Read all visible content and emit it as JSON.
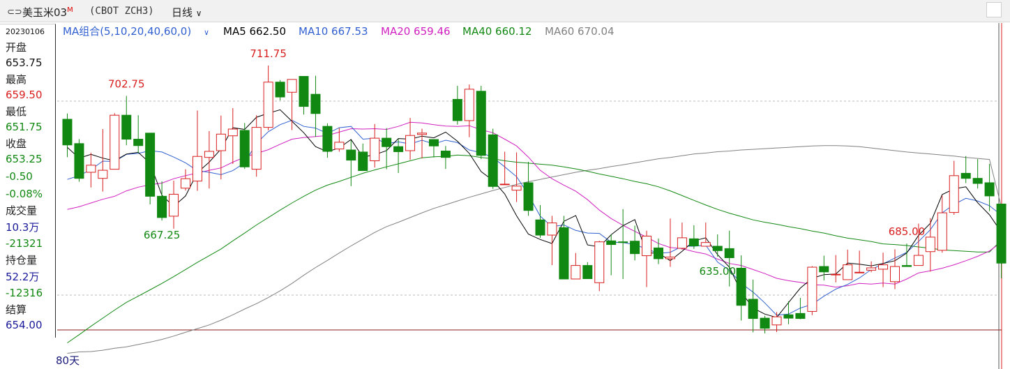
{
  "header": {
    "instrument_name": "美玉米03",
    "flag": "M",
    "code": "(CBOT ZCH3)",
    "period": "日线",
    "close_label": "□"
  },
  "info_panel": {
    "date": "20230106",
    "open_label": "开盘",
    "open_value": "653.75",
    "high_label": "最高",
    "high_value": "659.50",
    "low_label": "最低",
    "low_value": "651.75",
    "close_label": "收盘",
    "close_value": "653.25",
    "change_value": "-0.50",
    "change_pct": "-0.08%",
    "volume_label": "成交量",
    "volume_value": "10.3万",
    "volume_change": "-21321",
    "oi_label": "持仓量",
    "oi_value": "52.2万",
    "oi_change": "-12316",
    "settle_label": "结算",
    "settle_value": "654.00"
  },
  "legend": {
    "group_label": "MA组合(5,10,20,40,60,0)",
    "items": [
      {
        "text": "MA5 662.50",
        "color": "#000000"
      },
      {
        "text": "MA10 667.53",
        "color": "#3060d0"
      },
      {
        "text": "MA20 659.46",
        "color": "#d020c0"
      },
      {
        "text": "MA40 660.12",
        "color": "#118811"
      },
      {
        "text": "MA60 670.04",
        "color": "#808080"
      }
    ]
  },
  "bottom_label": "80天",
  "colors": {
    "up": "#d81e1e",
    "down": "#118811",
    "ma5": "#000000",
    "ma10": "#3060d0",
    "ma20": "#d020c0",
    "ma40": "#118811",
    "ma60": "#808080"
  },
  "chart_data": {
    "type": "candlestick",
    "ylim": [
      630,
      718
    ],
    "annotations": [
      {
        "text": "702.75",
        "kind": "high",
        "index": 5
      },
      {
        "text": "711.75",
        "kind": "high",
        "index": 17
      },
      {
        "text": "667.25",
        "kind": "low",
        "index": 8
      },
      {
        "text": "685.00",
        "kind": "high",
        "index": 71
      },
      {
        "text": "635.00",
        "kind": "low",
        "index": 55
      }
    ],
    "candles": [
      [
        695.9,
        688.3,
        697.6,
        684.7
      ],
      [
        688.7,
        678.4,
        690.0,
        677.4
      ],
      [
        680.2,
        682.3,
        686.0,
        675.7
      ],
      [
        678.4,
        680.8,
        693.0,
        674.5
      ],
      [
        681.1,
        697.1,
        697.7,
        681.1
      ],
      [
        697.1,
        690.0,
        702.8,
        688.2
      ],
      [
        690.0,
        688.1,
        697.1,
        685.9
      ],
      [
        691.8,
        673.1,
        691.8,
        670.7
      ],
      [
        673.1,
        666.8,
        677.5,
        665.9
      ],
      [
        667.2,
        673.7,
        677.7,
        663.5
      ],
      [
        675.5,
        678.3,
        681.1,
        674.8
      ],
      [
        677.6,
        684.9,
        698.5,
        674.7
      ],
      [
        684.6,
        686.4,
        692.4,
        675.4
      ],
      [
        686.6,
        691.5,
        697.0,
        678.1
      ],
      [
        691.0,
        693.0,
        699.2,
        682.7
      ],
      [
        692.6,
        681.8,
        694.8,
        681.2
      ],
      [
        681.1,
        693.5,
        697.1,
        678.9
      ],
      [
        693.5,
        706.9,
        711.8,
        692.6
      ],
      [
        706.9,
        702.5,
        707.5,
        701.5
      ],
      [
        703.9,
        707.7,
        707.2,
        692.7
      ],
      [
        708.6,
        699.7,
        707.0,
        697.3
      ],
      [
        703.3,
        697.6,
        708.8,
        690.7
      ],
      [
        693.8,
        686.4,
        694.7,
        684.5
      ],
      [
        687.1,
        689.1,
        693.3,
        686.3
      ],
      [
        686.8,
        683.8,
        689.7,
        676.1
      ],
      [
        686.2,
        680.7,
        688.7,
        680.7
      ],
      [
        683.6,
        690.3,
        694.5,
        681.6
      ],
      [
        690.3,
        687.8,
        693.3,
        681.1
      ],
      [
        687.8,
        686.3,
        690.1,
        680.0
      ],
      [
        686.6,
        691.1,
        696.3,
        683.9
      ],
      [
        691.4,
        691.8,
        693.1,
        684.3
      ],
      [
        689.9,
        688.0,
        689.8,
        684.6
      ],
      [
        686.5,
        684.6,
        688.0,
        681.2
      ],
      [
        701.8,
        695.5,
        705.8,
        694.3
      ],
      [
        695.5,
        704.8,
        706.2,
        690.6
      ],
      [
        704.2,
        685.2,
        705.8,
        684.1
      ],
      [
        691.3,
        676.0,
        693.1,
        675.3
      ],
      [
        676.7,
        676.7,
        686.3,
        676.5
      ],
      [
        674.9,
        676.1,
        686.1,
        671.4
      ],
      [
        677.1,
        668.9,
        683.3,
        667.3
      ],
      [
        666.1,
        661.6,
        670.5,
        660.8
      ],
      [
        661.6,
        665.2,
        667.3,
        652.7
      ],
      [
        663.8,
        648.6,
        667.3,
        648.7
      ],
      [
        648.6,
        652.6,
        656.3,
        648.8
      ],
      [
        652.6,
        648.7,
        653.6,
        648.9
      ],
      [
        647.5,
        659.6,
        659.9,
        645.0
      ],
      [
        659.9,
        658.8,
        661.8,
        649.7
      ],
      [
        659.6,
        659.4,
        669.3,
        648.6
      ],
      [
        659.8,
        656.1,
        664.4,
        654.1
      ],
      [
        655.5,
        661.3,
        662.9,
        646.2
      ],
      [
        657.8,
        654.6,
        660.6,
        653.0
      ],
      [
        654.6,
        655.1,
        666.5,
        652.2
      ],
      [
        657.7,
        660.8,
        665.3,
        657.3
      ],
      [
        660.5,
        658.4,
        664.5,
        657.5
      ],
      [
        658.3,
        659.4,
        665.3,
        658.7
      ],
      [
        658.3,
        657.0,
        661.8,
        655.2
      ],
      [
        657.6,
        654.9,
        662.9,
        646.4
      ],
      [
        651.8,
        640.8,
        655.6,
        636.3
      ],
      [
        642.6,
        636.9,
        648.4,
        632.8
      ],
      [
        637.0,
        634.0,
        637.7,
        632.5
      ],
      [
        635.0,
        637.4,
        638.8,
        632.9
      ],
      [
        638.0,
        637.0,
        642.0,
        635.2
      ],
      [
        638.4,
        636.9,
        643.0,
        636.7
      ],
      [
        639.0,
        652.1,
        652.4,
        637.9
      ],
      [
        652.3,
        650.7,
        655.5,
        648.2
      ],
      [
        650.0,
        650.0,
        655.7,
        647.6
      ],
      [
        648.4,
        652.8,
        657.3,
        651.0
      ],
      [
        650.6,
        650.6,
        657.0,
        653.2
      ],
      [
        651.2,
        651.9,
        653.8,
        650.6
      ],
      [
        651.5,
        652.8,
        656.4,
        646.2
      ],
      [
        647.8,
        652.3,
        657.4,
        645.6
      ],
      [
        652.6,
        652.3,
        659.1,
        652.9
      ],
      [
        652.6,
        655.6,
        665.0,
        652.6
      ],
      [
        656.7,
        661.0,
        666.6,
        650.8
      ],
      [
        657.1,
        668.2,
        673.3,
        656.4
      ],
      [
        668.3,
        679.2,
        683.6,
        667.6
      ],
      [
        679.9,
        678.4,
        685.0,
        677.0
      ],
      [
        678.4,
        676.9,
        684.1,
        675.4
      ],
      [
        677.1,
        673.2,
        682.7,
        668.7
      ],
      [
        670.8,
        653.3,
        670.9,
        648.8
      ]
    ],
    "ma": {
      "MA5": [
        687.6,
        684.4,
        685.5,
        684.4,
        683.6,
        685.6,
        686.1,
        682.9,
        673.4,
        670.1,
        673.2,
        680.1,
        683.2,
        687.1,
        693.4,
        692.9,
        696.5,
        697.7,
        698.7,
        695.3,
        691.9,
        687.8,
        686.3,
        687.4,
        689.9,
        684.7,
        685.4,
        686.6,
        690.2,
        690.0,
        690.9,
        690.4,
        692.1,
        689.4,
        685.8,
        680.4,
        677.8,
        673.8,
        667.3,
        661.9,
        660.3,
        659.1,
        665.7,
        667.4,
        658.7,
        658.1,
        661.7,
        664.4,
        666.2,
        656.3,
        656.3,
        654.0,
        656.8,
        659.9,
        660.8,
        655.8,
        652.1,
        644.7,
        640.0,
        638.2,
        637.2,
        641.6,
        645.9,
        648.8,
        649.9,
        650.1,
        653.3,
        653.0,
        652.5,
        653.2,
        654.0,
        656.3,
        661.5,
        665.1,
        673.6,
        675.3,
        675.9,
        671.2,
        667.6,
        662.5
      ],
      "MA10": [
        678.1,
        679.2,
        681.0,
        683.5,
        683.4,
        685.5,
        685.8,
        686.6,
        686.2,
        684.7,
        683.0,
        680.7,
        680.2,
        679.5,
        680.7,
        683.0,
        688.8,
        692.2,
        694.3,
        695.6,
        693.8,
        693.3,
        691.7,
        693.4,
        693.8,
        690.0,
        690.3,
        688.7,
        689.2,
        688.6,
        689.7,
        688.6,
        689.7,
        689.0,
        686.8,
        686.0,
        684.6,
        681.8,
        678.9,
        673.6,
        667.2,
        664.1,
        664.6,
        663.0,
        662.2,
        662.1,
        659.5,
        659.4,
        658.8,
        657.5,
        656.2,
        656.5,
        658.3,
        658.3,
        658.6,
        653.6,
        651.2,
        647.3,
        644.7,
        641.5,
        637.9,
        638.2,
        640.0,
        641.1,
        643.5,
        645.6,
        647.0,
        648.9,
        651.4,
        653.1,
        654.8,
        656.5,
        659.7,
        663.2,
        668.2,
        670.7,
        672.5,
        671.7,
        670.3,
        667.5
      ],
      "MA20": [
        669.2,
        670.0,
        671.1,
        672.2,
        673.1,
        674.7,
        675.8,
        676.5,
        677.0,
        678.3,
        679.2,
        680.0,
        680.8,
        681.5,
        683.2,
        684.7,
        685.8,
        686.9,
        688.5,
        690.0,
        690.5,
        690.8,
        691.1,
        692.1,
        693.1,
        693.0,
        693.1,
        692.9,
        693.8,
        695.0,
        694.8,
        694.3,
        693.9,
        693.8,
        694.0,
        692.8,
        691.9,
        690.0,
        688.0,
        684.7,
        680.8,
        678.3,
        676.4,
        674.6,
        672.1,
        669.0,
        666.5,
        664.5,
        662.7,
        661.0,
        659.1,
        657.9,
        657.6,
        656.7,
        656.0,
        654.5,
        653.2,
        652.6,
        651.4,
        650.2,
        648.8,
        648.1,
        647.6,
        646.9,
        646.8,
        646.2,
        646.6,
        647.3,
        647.1,
        647.4,
        647.1,
        648.6,
        650.4,
        651.0,
        651.8,
        652.8,
        654.0,
        655.3,
        656.9,
        659.5
      ],
      "MA40": [
        629.7,
        632.1,
        634.6,
        637.0,
        639.4,
        641.7,
        643.5,
        645.4,
        647.3,
        649.3,
        651.4,
        653.5,
        655.5,
        657.5,
        659.9,
        662.2,
        664.6,
        666.8,
        669.0,
        671.1,
        673.1,
        674.9,
        676.4,
        677.5,
        678.7,
        679.9,
        680.9,
        681.8,
        682.7,
        683.6,
        684.5,
        684.8,
        684.9,
        685.3,
        685.1,
        684.6,
        684.2,
        683.6,
        683.2,
        682.9,
        682.6,
        682.3,
        681.8,
        681.2,
        680.5,
        679.7,
        679.0,
        678.3,
        677.5,
        676.8,
        675.9,
        674.7,
        673.3,
        671.9,
        670.5,
        669.2,
        668.1,
        667.1,
        666.1,
        665.4,
        664.8,
        664.1,
        663.5,
        662.8,
        662.2,
        661.4,
        660.7,
        660.2,
        659.7,
        659.0,
        658.8,
        658.5,
        658.1,
        657.7,
        657.2,
        657.0,
        656.8,
        656.6,
        656.6,
        660.1
      ],
      "MA60": [
        626.6,
        627.0,
        627.1,
        627.5,
        628.1,
        628.5,
        629.2,
        629.9,
        630.7,
        631.7,
        632.8,
        633.9,
        635.0,
        636.4,
        638.0,
        639.7,
        641.3,
        643.1,
        645.1,
        647.3,
        649.7,
        652.0,
        654.1,
        656.3,
        658.4,
        660.4,
        662.4,
        664.1,
        665.4,
        666.8,
        668.2,
        669.5,
        670.6,
        671.7,
        672.8,
        673.8,
        674.8,
        675.7,
        676.6,
        677.4,
        678.1,
        678.8,
        679.5,
        680.2,
        680.8,
        681.3,
        681.9,
        682.4,
        683.0,
        683.6,
        684.2,
        684.6,
        685.1,
        685.6,
        685.9,
        686.3,
        686.5,
        686.8,
        687.0,
        687.2,
        687.4,
        687.6,
        687.8,
        688.0,
        688.1,
        688.1,
        688.0,
        687.8,
        687.4,
        687.0,
        686.6,
        686.2,
        685.9,
        685.6,
        685.3,
        685.0,
        684.6,
        684.3,
        684.0,
        670.0
      ]
    }
  }
}
